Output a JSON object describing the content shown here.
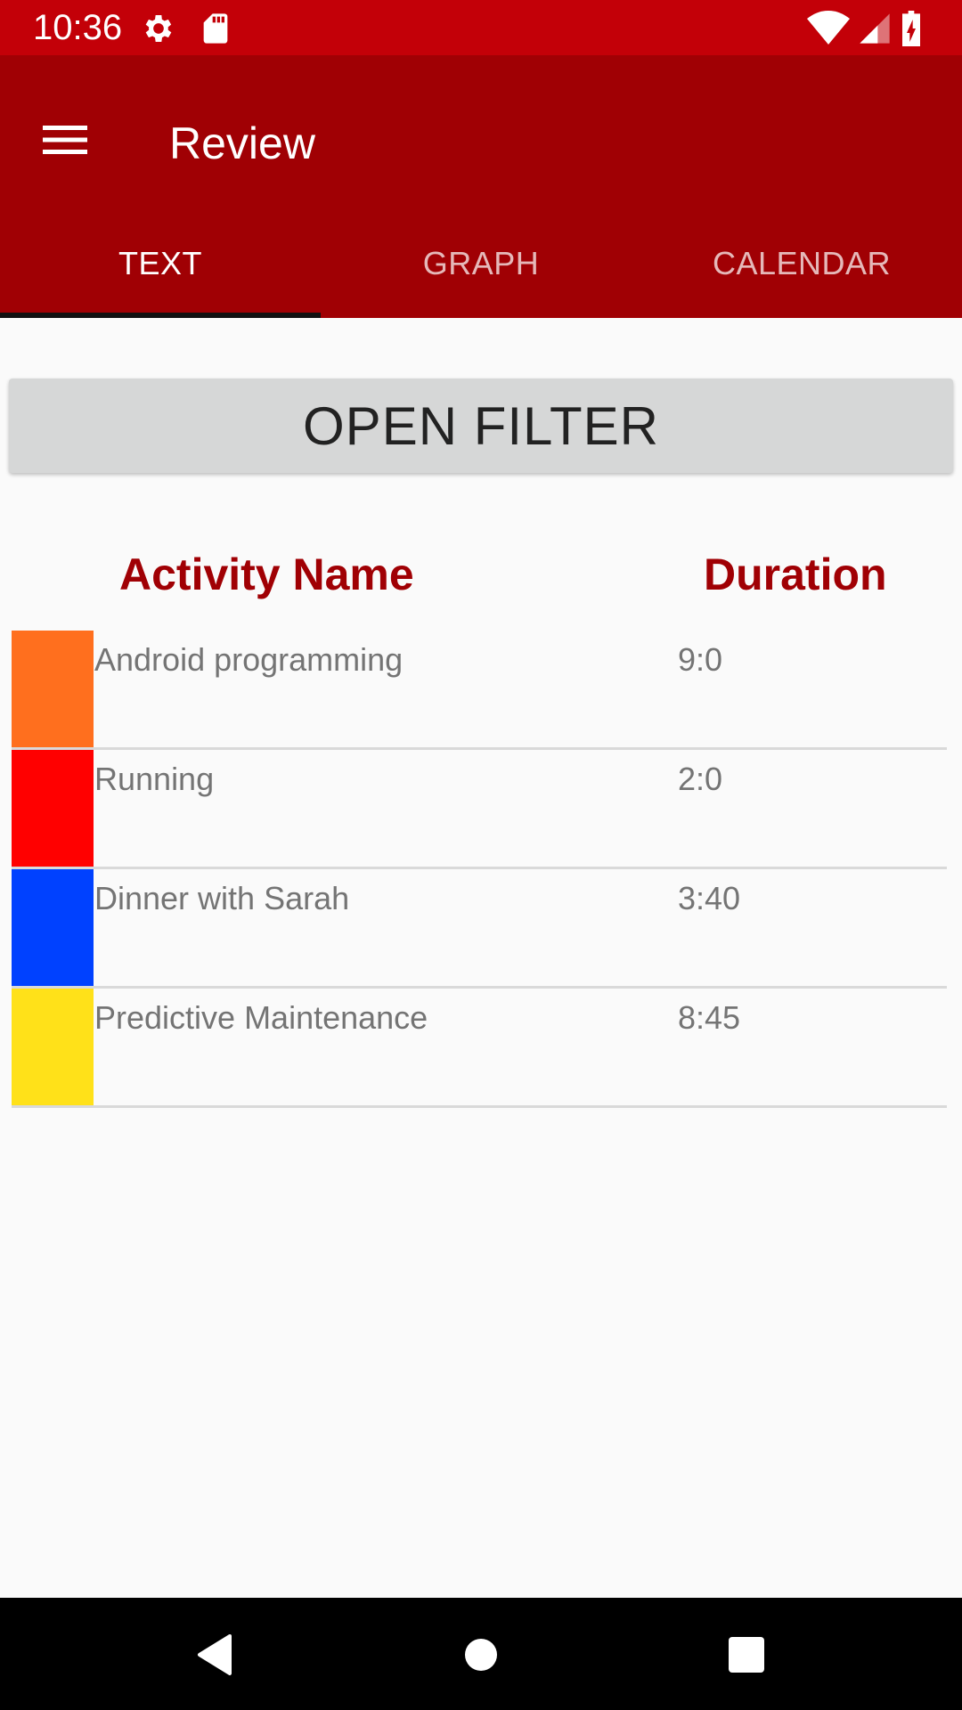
{
  "status_bar": {
    "time": "10:36",
    "icons": [
      "gear-icon",
      "sd-card-icon",
      "wifi-icon",
      "cell-signal-icon",
      "battery-charging-icon"
    ]
  },
  "app_bar": {
    "title": "Review",
    "menu_icon": "menu-icon",
    "tabs": [
      {
        "label": "TEXT",
        "active": true
      },
      {
        "label": "GRAPH",
        "active": false
      },
      {
        "label": "CALENDAR",
        "active": false
      }
    ]
  },
  "filter": {
    "label": "OPEN FILTER"
  },
  "table": {
    "headers": {
      "name": "Activity Name",
      "duration": "Duration"
    },
    "rows": [
      {
        "name": "Android programming",
        "duration": "9:0",
        "color": "#ff6f1e"
      },
      {
        "name": "Running",
        "duration": "2:0",
        "color": "#ff0000"
      },
      {
        "name": "Dinner with Sarah",
        "duration": "3:40",
        "color": "#0041ff"
      },
      {
        "name": "Predictive Maintenance",
        "duration": "8:45",
        "color": "#ffe119"
      }
    ]
  },
  "nav_bar": {
    "icons": [
      "back-icon",
      "home-icon",
      "recents-icon"
    ]
  },
  "colors": {
    "status_bar": "#c30008",
    "app_bar": "#a00004",
    "accent_text": "#a00004"
  }
}
